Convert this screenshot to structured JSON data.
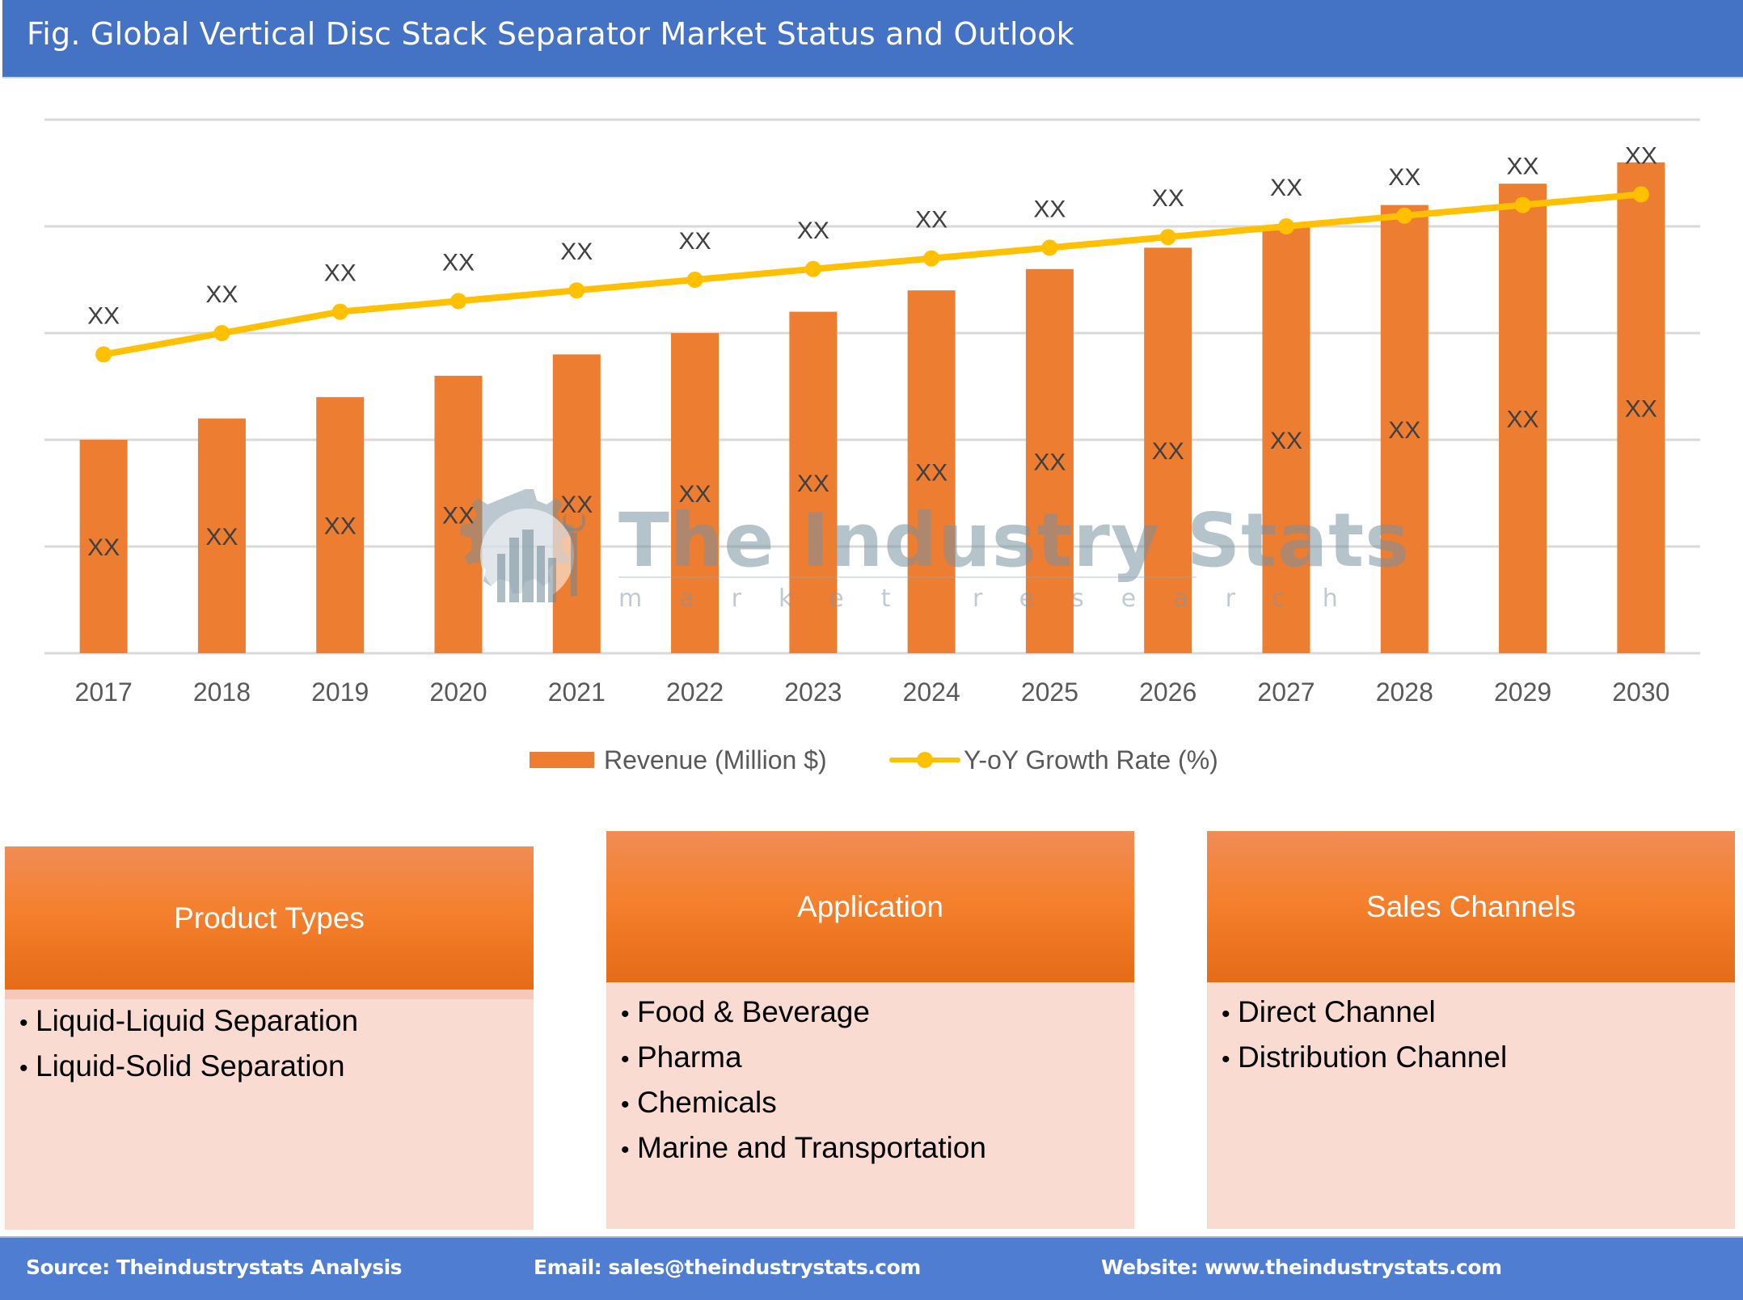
{
  "header": {
    "title": "Fig. Global Vertical Disc Stack Separator Market Status and Outlook"
  },
  "colors": {
    "title_bar": "#4472c4",
    "bar": "#ed7d31",
    "line": "#ffc000",
    "card_header": "#f5802d",
    "card_body": "#f9dbd2",
    "footer": "#4e7dd2"
  },
  "chart_data": {
    "type": "bar",
    "title": "",
    "xlabel": "",
    "ylabel": "",
    "categories": [
      "2017",
      "2018",
      "2019",
      "2020",
      "2021",
      "2022",
      "2023",
      "2024",
      "2025",
      "2026",
      "2027",
      "2028",
      "2029",
      "2030"
    ],
    "ylim": [
      0,
      100
    ],
    "gridlines": [
      0,
      20,
      40,
      60,
      80,
      100
    ],
    "grid": true,
    "y_tick_labels_shown": false,
    "series": [
      {
        "name": "Revenue (Million $)",
        "type": "bar",
        "values": [
          40,
          44,
          48,
          52,
          56,
          60,
          64,
          68,
          72,
          76,
          80,
          84,
          88,
          92
        ],
        "data_labels": [
          "XX",
          "XX",
          "XX",
          "XX",
          "XX",
          "XX",
          "XX",
          "XX",
          "XX",
          "XX",
          "XX",
          "XX",
          "XX",
          "XX"
        ],
        "note": "relative heights estimated; actual values masked as XX"
      },
      {
        "name": "Y-oY Growth Rate (%)",
        "type": "line",
        "values": [
          56,
          60,
          64,
          66,
          68,
          70,
          72,
          74,
          76,
          78,
          80,
          82,
          84,
          86
        ],
        "data_labels": [
          "XX",
          "XX",
          "XX",
          "XX",
          "XX",
          "XX",
          "XX",
          "XX",
          "XX",
          "XX",
          "XX",
          "XX",
          "XX",
          "XX"
        ],
        "note": "relative positions estimated; actual values masked as XX"
      }
    ],
    "legend": {
      "position": "bottom",
      "entries": [
        "Revenue (Million $)",
        "Y-oY Growth Rate (%)"
      ]
    }
  },
  "watermark": {
    "title": "The Industry Stats",
    "subtitle": "market research",
    "icon": "gear-factory-logo-icon"
  },
  "segments": [
    {
      "title": "Product Types",
      "items": [
        "Liquid-Liquid Separation",
        "Liquid-Solid Separation"
      ]
    },
    {
      "title": "Application",
      "items": [
        "Food & Beverage",
        "Pharma",
        "Chemicals",
        "Marine and Transportation"
      ]
    },
    {
      "title": "Sales Channels",
      "items": [
        "Direct Channel",
        "Distribution Channel"
      ]
    }
  ],
  "bullet": "•",
  "footer": {
    "source": "Source: Theindustrystats Analysis",
    "email": "Email: sales@theindustrystats.com",
    "website": "Website: www.theindustrystats.com"
  }
}
